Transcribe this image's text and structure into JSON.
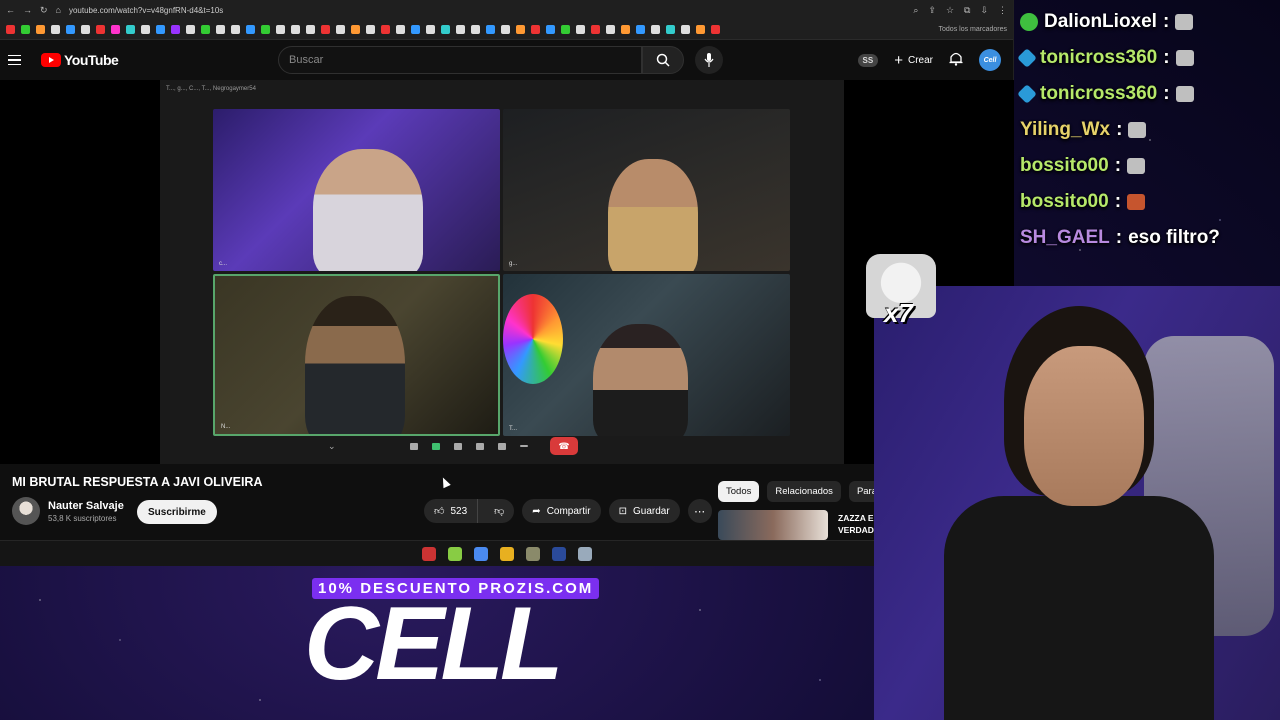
{
  "browser": {
    "url": "youtube.com/watch?v=v48gnfRN-d4&t=10s",
    "bookmarks_all": "Todos los marcadores",
    "bookmark_colors": [
      "#e33",
      "#3c3",
      "#f93",
      "#ddd",
      "#39f",
      "#ddd",
      "#e33",
      "#f3c",
      "#3cc",
      "#ddd",
      "#39f",
      "#93f",
      "#ddd",
      "#3c3",
      "#ddd",
      "#ddd",
      "#39f",
      "#3c3",
      "#ddd",
      "#ddd",
      "#ddd",
      "#e33",
      "#ddd",
      "#f93",
      "#ddd",
      "#e33",
      "#ddd",
      "#39f",
      "#ddd",
      "#3cc",
      "#ddd",
      "#ddd",
      "#39f",
      "#ddd",
      "#f93",
      "#e33",
      "#39f",
      "#3c3",
      "#ddd",
      "#e33",
      "#ddd",
      "#f93",
      "#39f",
      "#ddd",
      "#3cc",
      "#ddd",
      "#f93",
      "#e33"
    ]
  },
  "youtube": {
    "logo_text": "YouTube",
    "search_placeholder": "Buscar",
    "ss_badge": "SS",
    "create_label": "Crear",
    "avatar_text": "Cell"
  },
  "call": {
    "header": "T..., g..., C..., T..., Negrogaymer54",
    "tiles": [
      {
        "name": "c..."
      },
      {
        "name": "g..."
      },
      {
        "name": "N..."
      },
      {
        "name": "T..."
      }
    ]
  },
  "video": {
    "title": "MI BRUTAL RESPUESTA A JAVI OLIVEIRA",
    "channel": "Nauter Salvaje",
    "subscribers": "53,8 K suscriptores",
    "subscribe_label": "Suscribirme",
    "likes": "523",
    "share_label": "Compartir",
    "save_label": "Guardar"
  },
  "sidebar": {
    "chips": [
      "Todos",
      "Relacionados",
      "Para"
    ],
    "rec_title_line1": "ZAZZA E",
    "rec_title_line2": "VERDAD"
  },
  "taskbar_colors": [
    "#c33",
    "#8c4",
    "#4a8af0",
    "#e8b020",
    "#8a8a6a",
    "#2a4a9a",
    "#9ab"
  ],
  "chat": [
    {
      "user": "DalionLioxel",
      "color": "#ffffff",
      "badge": "cell",
      "sep": ":",
      "text": "",
      "emote": "cat"
    },
    {
      "user": "tonicross360",
      "color": "#b6e86a",
      "badge": "blue",
      "sep": ":",
      "text": "",
      "emote": "cat"
    },
    {
      "user": "tonicross360",
      "color": "#b6e86a",
      "badge": "blue",
      "sep": ":",
      "text": "",
      "emote": "cat"
    },
    {
      "user": "Yiling_Wx",
      "color": "#e6d26a",
      "badge": "",
      "sep": ":",
      "text": "",
      "emote": "cat"
    },
    {
      "user": "bossito00",
      "color": "#b6e86a",
      "badge": "",
      "sep": ":",
      "text": "",
      "emote": "cat"
    },
    {
      "user": "bossito00",
      "color": "#b6e86a",
      "badge": "",
      "sep": ":",
      "text": "",
      "emote": "fire"
    },
    {
      "user": "SH_GAEL",
      "color": "#b88ae0",
      "badge": "",
      "sep": ":",
      "text": "eso filtro?",
      "emote": ""
    }
  ],
  "overlay": {
    "emote_count": "x7",
    "promo": "10% DESCUENTO PROZIS.COM",
    "brand": "CELL"
  }
}
